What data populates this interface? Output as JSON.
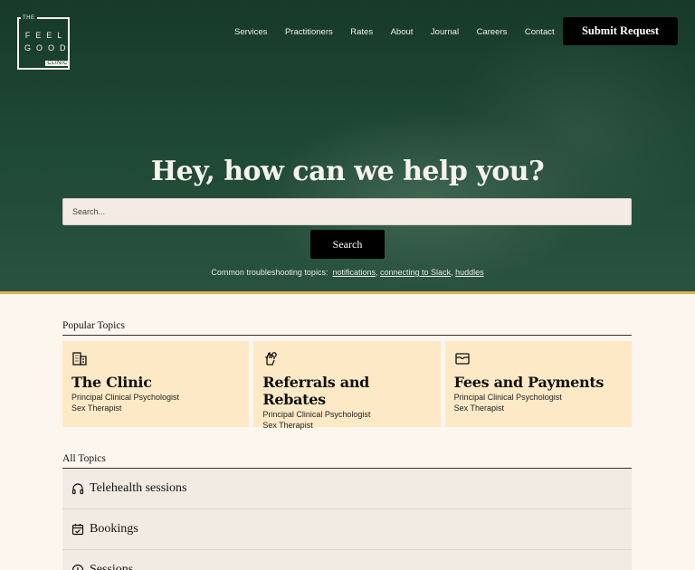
{
  "logo": {
    "the": "THE",
    "feel": "FEEL",
    "good": "GOOD",
    "clinic": "CLINIC"
  },
  "nav": {
    "items": [
      "Services",
      "Practitioners",
      "Rates",
      "About",
      "Journal",
      "Careers",
      "Contact"
    ],
    "submit_label": "Submit Request"
  },
  "hero": {
    "title": "Hey, how can we help you?",
    "search_placeholder": "Search...",
    "search_button": "Search",
    "common_prefix": "Common troubleshooting topics:",
    "common_links": [
      "notifications",
      "connecting to Slack",
      "huddles"
    ]
  },
  "popular": {
    "label": "Popular Topics",
    "cards": [
      {
        "icon": "building-icon",
        "title": "The Clinic",
        "line1": "Principal Clinical Psychologist",
        "line2": "Sex Therapist"
      },
      {
        "icon": "hand-coin-icon",
        "title": "Referrals and Rebates",
        "line1": "Principal Clinical Psychologist",
        "line2": "Sex Therapist"
      },
      {
        "icon": "wallet-icon",
        "title": "Fees and Payments",
        "line1": "Principal Clinical Psychologist",
        "line2": "Sex Therapist"
      }
    ]
  },
  "all_topics": {
    "label": "All Topics",
    "items": [
      {
        "icon": "headphones-icon",
        "label": "Telehealth sessions"
      },
      {
        "icon": "calendar-check-icon",
        "label": "Bookings"
      },
      {
        "icon": "clock-icon",
        "label": "Sessions"
      }
    ]
  },
  "colors": {
    "hero_green": "#1f4a36",
    "accent_gold": "#d6b25c",
    "card_bg": "#fde9c6",
    "page_bg": "#fcf6ee",
    "button_black": "#000000"
  }
}
